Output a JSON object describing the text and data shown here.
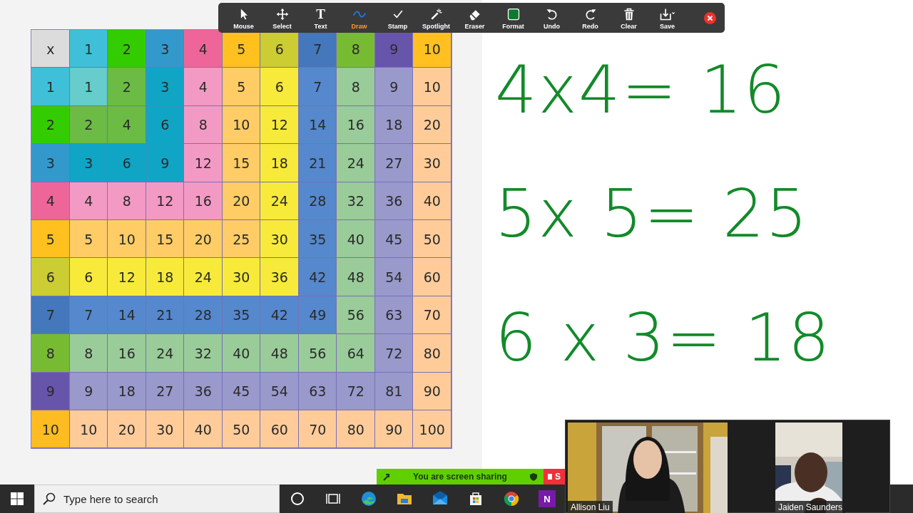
{
  "toolbar": {
    "tools": [
      {
        "kind": "mouse",
        "label": "Mouse",
        "selected": false
      },
      {
        "kind": "select",
        "label": "Select",
        "selected": false
      },
      {
        "kind": "text",
        "label": "Text",
        "glyph": "T",
        "selected": false
      },
      {
        "kind": "draw",
        "label": "Draw",
        "selected": true
      },
      {
        "kind": "stamp",
        "label": "Stamp",
        "selected": false
      },
      {
        "kind": "spotlight",
        "label": "Spotlight",
        "selected": false
      },
      {
        "kind": "eraser",
        "label": "Eraser",
        "selected": false
      },
      {
        "kind": "format",
        "label": "Format",
        "selected": false
      },
      {
        "kind": "undo",
        "label": "Undo",
        "selected": false
      },
      {
        "kind": "redo",
        "label": "Redo",
        "selected": false
      },
      {
        "kind": "clear",
        "label": "Clear",
        "selected": false
      },
      {
        "kind": "save",
        "label": "Save",
        "selected": false
      }
    ]
  },
  "table": {
    "corner": {
      "label": "x",
      "color": "#dcdcdc"
    },
    "columns": [
      {
        "label": "1",
        "color": "#40c0d8"
      },
      {
        "label": "2",
        "color": "#33cc00"
      },
      {
        "label": "3",
        "color": "#3399cc"
      },
      {
        "label": "4",
        "color": "#ee6699"
      },
      {
        "label": "5",
        "color": "#ffc020"
      },
      {
        "label": "6",
        "color": "#cccc33"
      },
      {
        "label": "7",
        "color": "#4477bb"
      },
      {
        "label": "8",
        "color": "#77bb33"
      },
      {
        "label": "9",
        "color": "#6655aa"
      },
      {
        "label": "10",
        "color": "#ffc020"
      }
    ],
    "band_colors": [
      {
        "color": "#66cccc"
      },
      {
        "color": "#6bbb44"
      },
      {
        "color": "#11a5c5"
      },
      {
        "color": "#f39ac4"
      },
      {
        "color": "#ffcc66"
      },
      {
        "color": "#f7ea3a"
      },
      {
        "color": "#5588cc"
      },
      {
        "color": "#99cc99"
      },
      {
        "color": "#9999cc"
      },
      {
        "color": "#ffcc99"
      }
    ],
    "rows": [
      {
        "label": "1",
        "color": "#40c0d8",
        "cells": [
          "1",
          "2",
          "3",
          "4",
          "5",
          "6",
          "7",
          "8",
          "9",
          "10"
        ]
      },
      {
        "label": "2",
        "color": "#33cc00",
        "cells": [
          "2",
          "4",
          "6",
          "8",
          "10",
          "12",
          "14",
          "16",
          "18",
          "20"
        ]
      },
      {
        "label": "3",
        "color": "#3399cc",
        "cells": [
          "3",
          "6",
          "9",
          "12",
          "15",
          "18",
          "21",
          "24",
          "27",
          "30"
        ]
      },
      {
        "label": "4",
        "color": "#ee6699",
        "cells": [
          "4",
          "8",
          "12",
          "16",
          "20",
          "24",
          "28",
          "32",
          "36",
          "40"
        ]
      },
      {
        "label": "5",
        "color": "#ffc020",
        "cells": [
          "5",
          "10",
          "15",
          "20",
          "25",
          "30",
          "35",
          "40",
          "45",
          "50"
        ]
      },
      {
        "label": "6",
        "color": "#cccc33",
        "cells": [
          "6",
          "12",
          "18",
          "24",
          "30",
          "36",
          "42",
          "48",
          "54",
          "60"
        ]
      },
      {
        "label": "7",
        "color": "#4477bb",
        "cells": [
          "7",
          "14",
          "21",
          "28",
          "35",
          "42",
          "49",
          "56",
          "63",
          "70"
        ]
      },
      {
        "label": "8",
        "color": "#77bb33",
        "cells": [
          "8",
          "16",
          "24",
          "32",
          "40",
          "48",
          "56",
          "64",
          "72",
          "80"
        ]
      },
      {
        "label": "9",
        "color": "#6655aa",
        "cells": [
          "9",
          "18",
          "27",
          "36",
          "45",
          "54",
          "63",
          "72",
          "81",
          "90"
        ]
      },
      {
        "label": "10",
        "color": "#ffbb22",
        "cells": [
          "10",
          "20",
          "30",
          "40",
          "50",
          "60",
          "70",
          "80",
          "90",
          "100"
        ]
      }
    ]
  },
  "annotations": [
    "4x4= 16",
    "5x 5= 25",
    "6 x 3= 18"
  ],
  "share_bar": {
    "label": "You are screen sharing",
    "stop_label": "S"
  },
  "participants": [
    {
      "name": "Allison Liu",
      "kind": "picture"
    },
    {
      "name": "Jaiden Saunders",
      "kind": "picture"
    }
  ],
  "taskbar": {
    "search": {
      "placeholder": "Type here to search"
    },
    "apps": [
      {
        "kind": "cortana"
      },
      {
        "kind": "taskview"
      },
      {
        "kind": "edge"
      },
      {
        "kind": "explorer"
      },
      {
        "kind": "mail"
      },
      {
        "kind": "store"
      },
      {
        "kind": "chrome"
      },
      {
        "kind": "onenote",
        "glyph": "N"
      }
    ]
  }
}
